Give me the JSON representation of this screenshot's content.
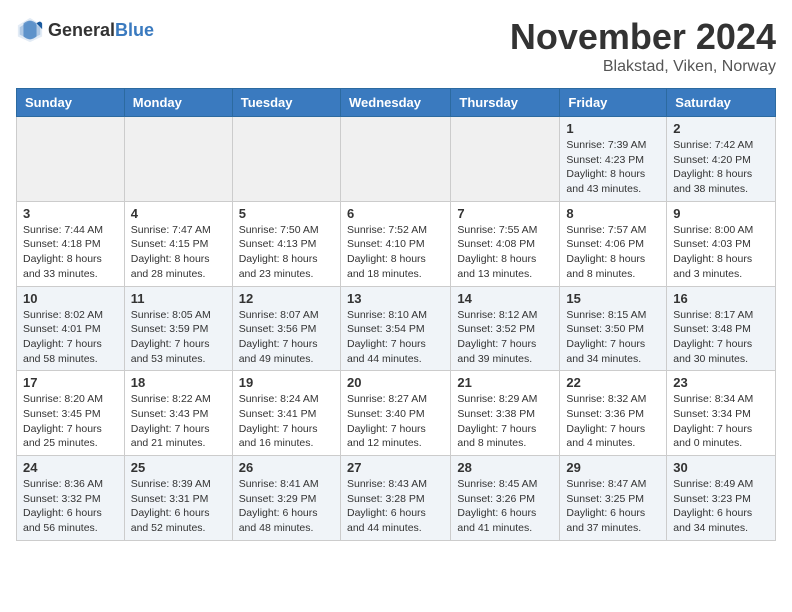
{
  "header": {
    "logo_general": "General",
    "logo_blue": "Blue",
    "title": "November 2024",
    "location": "Blakstad, Viken, Norway"
  },
  "days_of_week": [
    "Sunday",
    "Monday",
    "Tuesday",
    "Wednesday",
    "Thursday",
    "Friday",
    "Saturday"
  ],
  "weeks": [
    [
      {
        "day": "",
        "info": ""
      },
      {
        "day": "",
        "info": ""
      },
      {
        "day": "",
        "info": ""
      },
      {
        "day": "",
        "info": ""
      },
      {
        "day": "",
        "info": ""
      },
      {
        "day": "1",
        "info": "Sunrise: 7:39 AM\nSunset: 4:23 PM\nDaylight: 8 hours\nand 43 minutes."
      },
      {
        "day": "2",
        "info": "Sunrise: 7:42 AM\nSunset: 4:20 PM\nDaylight: 8 hours\nand 38 minutes."
      }
    ],
    [
      {
        "day": "3",
        "info": "Sunrise: 7:44 AM\nSunset: 4:18 PM\nDaylight: 8 hours\nand 33 minutes."
      },
      {
        "day": "4",
        "info": "Sunrise: 7:47 AM\nSunset: 4:15 PM\nDaylight: 8 hours\nand 28 minutes."
      },
      {
        "day": "5",
        "info": "Sunrise: 7:50 AM\nSunset: 4:13 PM\nDaylight: 8 hours\nand 23 minutes."
      },
      {
        "day": "6",
        "info": "Sunrise: 7:52 AM\nSunset: 4:10 PM\nDaylight: 8 hours\nand 18 minutes."
      },
      {
        "day": "7",
        "info": "Sunrise: 7:55 AM\nSunset: 4:08 PM\nDaylight: 8 hours\nand 13 minutes."
      },
      {
        "day": "8",
        "info": "Sunrise: 7:57 AM\nSunset: 4:06 PM\nDaylight: 8 hours\nand 8 minutes."
      },
      {
        "day": "9",
        "info": "Sunrise: 8:00 AM\nSunset: 4:03 PM\nDaylight: 8 hours\nand 3 minutes."
      }
    ],
    [
      {
        "day": "10",
        "info": "Sunrise: 8:02 AM\nSunset: 4:01 PM\nDaylight: 7 hours\nand 58 minutes."
      },
      {
        "day": "11",
        "info": "Sunrise: 8:05 AM\nSunset: 3:59 PM\nDaylight: 7 hours\nand 53 minutes."
      },
      {
        "day": "12",
        "info": "Sunrise: 8:07 AM\nSunset: 3:56 PM\nDaylight: 7 hours\nand 49 minutes."
      },
      {
        "day": "13",
        "info": "Sunrise: 8:10 AM\nSunset: 3:54 PM\nDaylight: 7 hours\nand 44 minutes."
      },
      {
        "day": "14",
        "info": "Sunrise: 8:12 AM\nSunset: 3:52 PM\nDaylight: 7 hours\nand 39 minutes."
      },
      {
        "day": "15",
        "info": "Sunrise: 8:15 AM\nSunset: 3:50 PM\nDaylight: 7 hours\nand 34 minutes."
      },
      {
        "day": "16",
        "info": "Sunrise: 8:17 AM\nSunset: 3:48 PM\nDaylight: 7 hours\nand 30 minutes."
      }
    ],
    [
      {
        "day": "17",
        "info": "Sunrise: 8:20 AM\nSunset: 3:45 PM\nDaylight: 7 hours\nand 25 minutes."
      },
      {
        "day": "18",
        "info": "Sunrise: 8:22 AM\nSunset: 3:43 PM\nDaylight: 7 hours\nand 21 minutes."
      },
      {
        "day": "19",
        "info": "Sunrise: 8:24 AM\nSunset: 3:41 PM\nDaylight: 7 hours\nand 16 minutes."
      },
      {
        "day": "20",
        "info": "Sunrise: 8:27 AM\nSunset: 3:40 PM\nDaylight: 7 hours\nand 12 minutes."
      },
      {
        "day": "21",
        "info": "Sunrise: 8:29 AM\nSunset: 3:38 PM\nDaylight: 7 hours\nand 8 minutes."
      },
      {
        "day": "22",
        "info": "Sunrise: 8:32 AM\nSunset: 3:36 PM\nDaylight: 7 hours\nand 4 minutes."
      },
      {
        "day": "23",
        "info": "Sunrise: 8:34 AM\nSunset: 3:34 PM\nDaylight: 7 hours\nand 0 minutes."
      }
    ],
    [
      {
        "day": "24",
        "info": "Sunrise: 8:36 AM\nSunset: 3:32 PM\nDaylight: 6 hours\nand 56 minutes."
      },
      {
        "day": "25",
        "info": "Sunrise: 8:39 AM\nSunset: 3:31 PM\nDaylight: 6 hours\nand 52 minutes."
      },
      {
        "day": "26",
        "info": "Sunrise: 8:41 AM\nSunset: 3:29 PM\nDaylight: 6 hours\nand 48 minutes."
      },
      {
        "day": "27",
        "info": "Sunrise: 8:43 AM\nSunset: 3:28 PM\nDaylight: 6 hours\nand 44 minutes."
      },
      {
        "day": "28",
        "info": "Sunrise: 8:45 AM\nSunset: 3:26 PM\nDaylight: 6 hours\nand 41 minutes."
      },
      {
        "day": "29",
        "info": "Sunrise: 8:47 AM\nSunset: 3:25 PM\nDaylight: 6 hours\nand 37 minutes."
      },
      {
        "day": "30",
        "info": "Sunrise: 8:49 AM\nSunset: 3:23 PM\nDaylight: 6 hours\nand 34 minutes."
      }
    ]
  ]
}
